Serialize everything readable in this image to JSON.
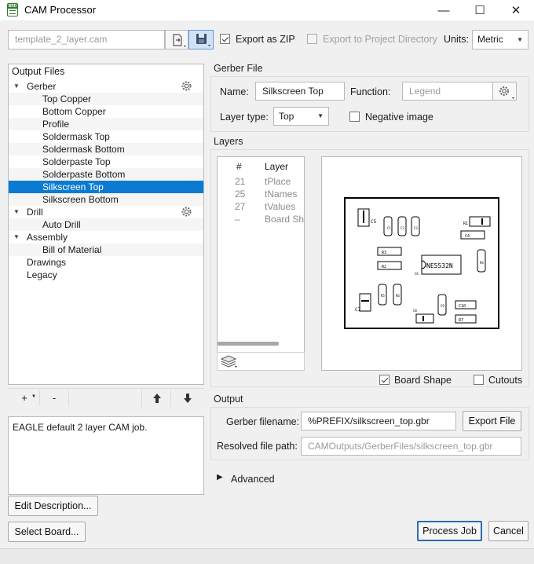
{
  "window": {
    "title": "CAM Processor",
    "icon_text": "BRD",
    "minimize": "—",
    "maximize": "☐",
    "close": "✕"
  },
  "toolbar": {
    "job_file": "template_2_layer.cam",
    "export_zip_label": "Export as ZIP",
    "export_zip_checked": true,
    "export_project_label": "Export to Project Directory",
    "export_project_checked": false,
    "units_label": "Units:",
    "units_value": "Metric"
  },
  "output_files": {
    "header": "Output Files",
    "items": [
      {
        "label": "Gerber",
        "level": 0,
        "expanded": true,
        "gear": true
      },
      {
        "label": "Top Copper",
        "level": 1
      },
      {
        "label": "Bottom Copper",
        "level": 1
      },
      {
        "label": "Profile",
        "level": 1
      },
      {
        "label": "Soldermask Top",
        "level": 1
      },
      {
        "label": "Soldermask Bottom",
        "level": 1
      },
      {
        "label": "Solderpaste Top",
        "level": 1
      },
      {
        "label": "Solderpaste Bottom",
        "level": 1
      },
      {
        "label": "Silkscreen Top",
        "level": 1,
        "selected": true
      },
      {
        "label": "Silkscreen Bottom",
        "level": 1
      },
      {
        "label": "Drill",
        "level": 0,
        "expanded": true,
        "gear": true
      },
      {
        "label": "Auto Drill",
        "level": 1
      },
      {
        "label": "Assembly",
        "level": 0,
        "expanded": true
      },
      {
        "label": "Bill of Material",
        "level": 1
      },
      {
        "label": "Drawings",
        "level": 0
      },
      {
        "label": "Legacy",
        "level": 0
      }
    ],
    "add_label": "+",
    "remove_label": "-",
    "up_icon": "arrow-up-icon",
    "down_icon": "arrow-down-icon"
  },
  "description": {
    "text": "EAGLE default 2 layer CAM job.",
    "edit_button": "Edit Description...",
    "select_board_button": "Select Board..."
  },
  "gerber_file": {
    "group_title": "Gerber File",
    "name_label": "Name:",
    "name_value": "Silkscreen Top",
    "function_label": "Function:",
    "function_placeholder": "Legend",
    "layer_type_label": "Layer type:",
    "layer_type_value": "Top",
    "negative_label": "Negative image",
    "negative_checked": false
  },
  "layers": {
    "group_title": "Layers",
    "col_num": "#",
    "col_layer": "Layer",
    "rows": [
      {
        "num": "21",
        "name": "tPlace"
      },
      {
        "num": "25",
        "name": "tNames"
      },
      {
        "num": "27",
        "name": "tValues"
      },
      {
        "num": "–",
        "name": "Board Shape"
      }
    ],
    "board_shape_label": "Board Shape",
    "board_shape_checked": true,
    "cutouts_label": "Cutouts",
    "cutouts_checked": false,
    "preview_chip_label": "NE5532N",
    "preview_small_labels": [
      "C5",
      "C1",
      "C2",
      "C3",
      "R1",
      "C4",
      "R3",
      "R2",
      "C6",
      "R4",
      "C7",
      "R5",
      "R6",
      "C8",
      "C9",
      "C10",
      "R7"
    ]
  },
  "output": {
    "group_title": "Output",
    "gerber_filename_label": "Gerber filename:",
    "gerber_filename_value": "%PREFIX/silkscreen_top.gbr",
    "export_file_button": "Export File",
    "resolved_label": "Resolved file path:",
    "resolved_value": "CAMOutputs/GerberFiles/silkscreen_top.gbr",
    "advanced_label": "Advanced"
  },
  "footer": {
    "process_job_button": "Process Job",
    "cancel_button": "Cancel"
  },
  "colors": {
    "selection": "#0a7bd0",
    "primary_border": "#2b6cb0",
    "icon_green": "#2d7a2d"
  }
}
